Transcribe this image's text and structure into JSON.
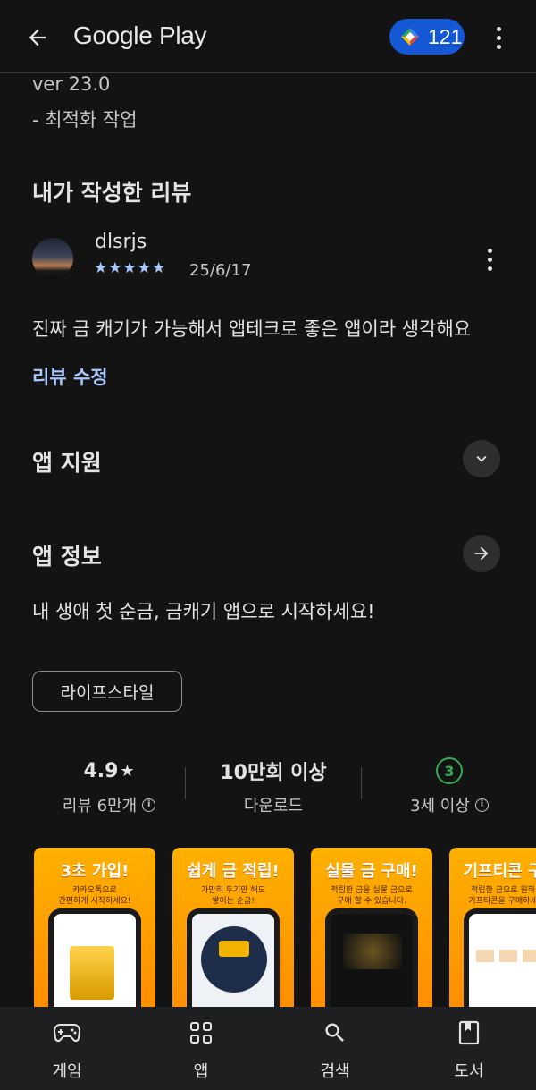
{
  "header": {
    "brand": "Google Play",
    "points": "121"
  },
  "whats_new": {
    "version": "ver 23.0",
    "note": "- 최적화 작업"
  },
  "my_review": {
    "title": "내가 작성한 리뷰",
    "reviewer": "dlsrjs",
    "stars": "★★★★★",
    "rating": 5,
    "date": "25/6/17",
    "text": "진짜 금 캐기가 가능해서 앱테크로 좋은 앱이라 생각해요",
    "edit_label": "리뷰 수정"
  },
  "app_support": {
    "title": "앱 지원"
  },
  "app_info": {
    "title": "앱 정보",
    "description": "내 생애 첫 순금, 금캐기 앱으로 시작하세요!",
    "category_chip": "라이프스타일"
  },
  "stats": {
    "rating": "4.9",
    "rating_star": "★",
    "reviews": "리뷰 6만개",
    "downloads": "10만회 이상",
    "downloads_label": "다운로드",
    "age_badge": "3",
    "age_label": "3세 이상"
  },
  "screenshots": [
    {
      "headline": "3초 가입!",
      "sub1": "카카오톡으로",
      "sub2": "간편하게 시작하세요!"
    },
    {
      "headline": "쉽게 금 적립!",
      "sub1": "가만히 두기만 해도",
      "sub2": "쌓이는 순금!"
    },
    {
      "headline": "실물 금 구매!",
      "sub1": "적립한 금을 실물 금으로",
      "sub2": "구매 할 수 있습니다."
    },
    {
      "headline": "기프티콘 구",
      "sub1": "적립한 금으로 원하",
      "sub2": "기프티콘을 구매하세"
    }
  ],
  "bottom_nav": [
    {
      "label": "게임",
      "icon": "gamepad-icon"
    },
    {
      "label": "앱",
      "icon": "apps-grid-icon"
    },
    {
      "label": "검색",
      "icon": "search-icon"
    },
    {
      "label": "도서",
      "icon": "book-icon"
    }
  ],
  "colors": {
    "background": "#131314",
    "accent_link": "#a8c7fa",
    "points_pill": "#1558d6",
    "age_green": "#34a853"
  }
}
